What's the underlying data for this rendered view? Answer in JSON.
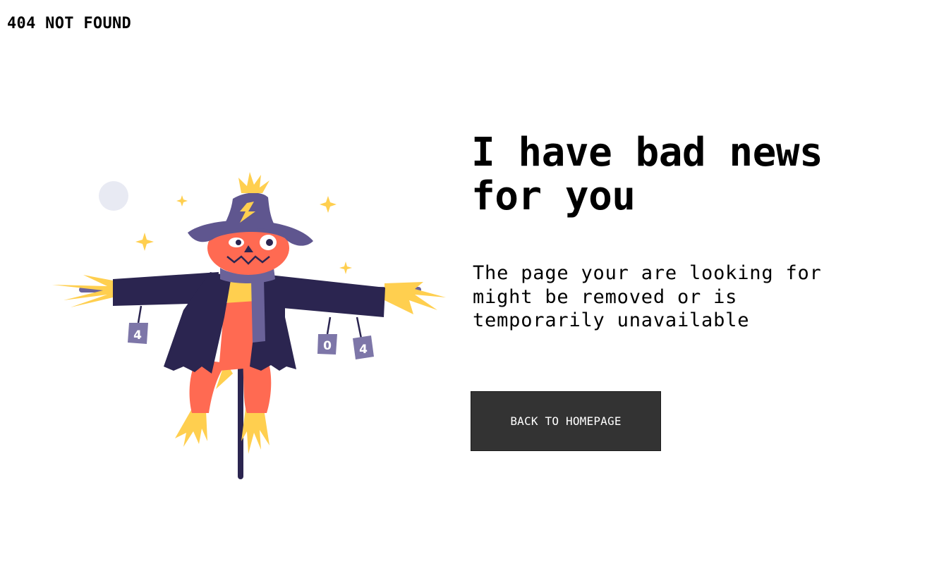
{
  "header": {
    "title": "404 NOT FOUND"
  },
  "main": {
    "headline": "I have bad news for you",
    "message": "The page your are looking for might be removed or is temporarily unavailable",
    "button_label": "BACK TO HOMEPAGE"
  },
  "illustration": {
    "icon": "scarecrow-icon",
    "can_labels": [
      "4",
      "0",
      "4"
    ],
    "colors": {
      "hat": "#5f568f",
      "coat": "#2b2550",
      "face": "#ff6a52",
      "straw": "#ffcf4f",
      "scarf": "#6a6299",
      "cans": "#7d76a8",
      "moon": "#e8eaf3"
    }
  }
}
